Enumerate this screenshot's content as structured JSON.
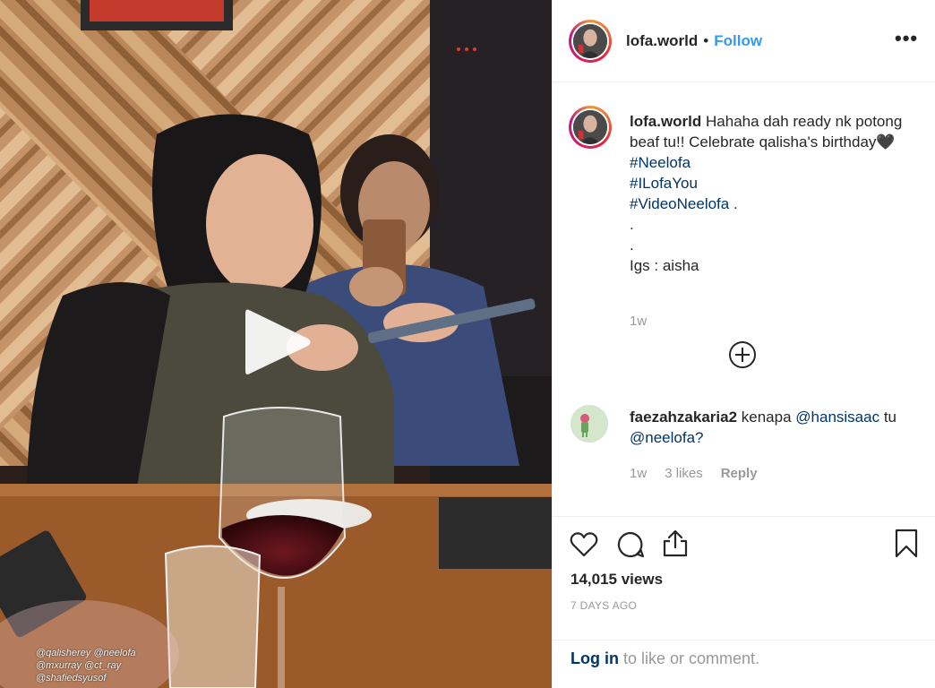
{
  "video": {
    "tag_lines": [
      "@qalisherey @neelofa",
      "@mxurray @ct_ray",
      "@shafiedsyusof"
    ]
  },
  "header": {
    "username": "lofa.world",
    "separator": "•",
    "follow_label": "Follow",
    "more_icon": "more-options-icon"
  },
  "caption": {
    "username": "lofa.world",
    "text": "Hahaha dah ready nk potong beaf tu!! Celebrate qalisha's birthday🖤",
    "hashtags": [
      "#Neelofa",
      "#ILofaYou",
      "#VideoNeelofa ."
    ],
    "dot_lines": [
      ".",
      "."
    ],
    "credit": "Igs : aisha",
    "time": "1w"
  },
  "comment": {
    "username": "faezahzakaria2",
    "text_before": "kenapa",
    "mention1": "@hansisaac",
    "text_mid": "tu",
    "mention2": "@neelofa?",
    "time": "1w",
    "likes": "3 likes",
    "reply_label": "Reply"
  },
  "stats": {
    "views": "14,015 views",
    "date": "7 DAYS AGO"
  },
  "login": {
    "link": "Log in",
    "rest": "to like or comment."
  },
  "colors": {
    "link_blue": "#3897f0",
    "text_dark": "#262626",
    "muted": "#999999",
    "hashtag": "#003569"
  }
}
